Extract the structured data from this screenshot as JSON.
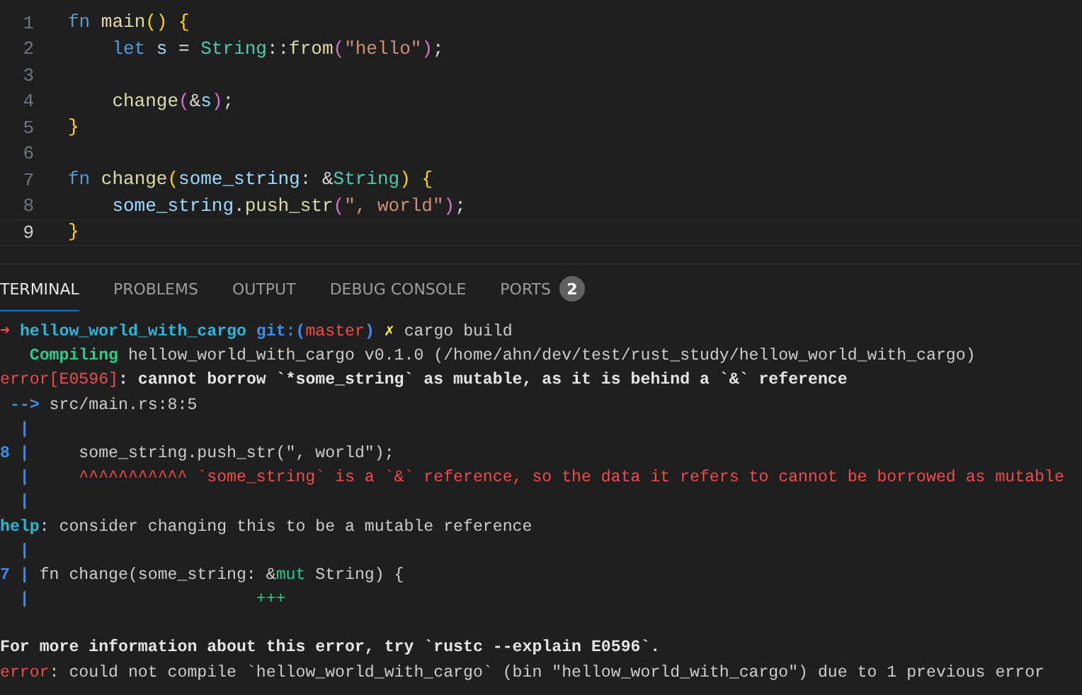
{
  "editor": {
    "lines": [
      {
        "number": "1",
        "current": false,
        "tokens": [
          {
            "kind": "keyword",
            "text": "fn"
          },
          {
            "kind": "function",
            "text": " main"
          },
          {
            "kind": "bracket",
            "text": "()"
          },
          {
            "kind": "bracket",
            "text": " {"
          }
        ]
      },
      {
        "number": "2",
        "current": false,
        "tokens": [
          {
            "kind": "keyword",
            "text": "    let"
          },
          {
            "kind": "variable",
            "text": " s"
          },
          {
            "kind": "plain",
            "text": " = "
          },
          {
            "kind": "type",
            "text": "String"
          },
          {
            "kind": "plain",
            "text": "::"
          },
          {
            "kind": "function",
            "text": "from"
          },
          {
            "kind": "bracket2",
            "text": "("
          },
          {
            "kind": "string",
            "text": "\"hello\""
          },
          {
            "kind": "bracket2",
            "text": ")"
          },
          {
            "kind": "plain",
            "text": ";"
          }
        ]
      },
      {
        "number": "3",
        "current": false
      },
      {
        "number": "4",
        "current": false,
        "tokens": [
          {
            "kind": "function",
            "text": "    change"
          },
          {
            "kind": "bracket2",
            "text": "("
          },
          {
            "kind": "plain",
            "text": "&"
          },
          {
            "kind": "variable",
            "text": "s"
          },
          {
            "kind": "bracket2",
            "text": ")"
          },
          {
            "kind": "plain",
            "text": ";"
          }
        ]
      },
      {
        "number": "5",
        "current": false,
        "tokens": [
          {
            "kind": "bracket",
            "text": "}"
          }
        ]
      },
      {
        "number": "6",
        "current": false
      },
      {
        "number": "7",
        "current": false,
        "tokens": [
          {
            "kind": "keyword",
            "text": "fn"
          },
          {
            "kind": "function",
            "text": " change"
          },
          {
            "kind": "bracket",
            "text": "("
          },
          {
            "kind": "variable",
            "text": "some_string"
          },
          {
            "kind": "plain",
            "text": ": &"
          },
          {
            "kind": "type",
            "text": "String"
          },
          {
            "kind": "bracket",
            "text": ")"
          },
          {
            "kind": "bracket",
            "text": " {"
          }
        ]
      },
      {
        "number": "8",
        "current": false,
        "tokens": [
          {
            "kind": "variable",
            "text": "    some_string"
          },
          {
            "kind": "plain",
            "text": "."
          },
          {
            "kind": "function",
            "text": "push_str"
          },
          {
            "kind": "bracket2",
            "text": "("
          },
          {
            "kind": "string",
            "text": "\", world\""
          },
          {
            "kind": "bracket2",
            "text": ")"
          },
          {
            "kind": "plain",
            "text": ";"
          }
        ]
      },
      {
        "number": "9",
        "current": true,
        "tokens": [
          {
            "kind": "bracket",
            "text": "}"
          }
        ]
      }
    ]
  },
  "panel_tabs": [
    {
      "label": "TERMINAL",
      "selected": true
    },
    {
      "label": "PROBLEMS",
      "selected": false
    },
    {
      "label": "OUTPUT",
      "selected": false
    },
    {
      "label": "DEBUG CONSOLE",
      "selected": false
    },
    {
      "label": "PORTS",
      "selected": false,
      "badge": "2"
    }
  ],
  "terminal": {
    "lines": [
      {
        "tokens": [
          {
            "kind": "red",
            "text": "➜ "
          },
          {
            "kind": "cyanbold",
            "text": "hellow_world_with_cargo"
          },
          {
            "kind": "bluebold",
            "text": " git:("
          },
          {
            "kind": "redbold",
            "text": "master"
          },
          {
            "kind": "bluebold",
            "text": ")"
          },
          {
            "kind": "yellow",
            "text": " ✗ "
          },
          {
            "kind": "plain",
            "text": "cargo build"
          }
        ]
      },
      {
        "tokens": [
          {
            "kind": "greenbold",
            "text": "   Compiling"
          },
          {
            "kind": "plain",
            "text": " hellow_world_with_cargo v0.1.0 (/home/ahn/dev/test/rust_study/hellow_world_with_cargo)"
          }
        ]
      },
      {
        "tokens": [
          {
            "kind": "redbold",
            "text": "error[E0596]"
          },
          {
            "kind": "bold",
            "text": ": cannot borrow `*some_string` as mutable, as it is behind a `&` reference"
          }
        ]
      },
      {
        "tokens": [
          {
            "kind": "bluebold",
            "text": " --> "
          },
          {
            "kind": "plain",
            "text": "src/main.rs:8:5"
          }
        ]
      },
      {
        "tokens": [
          {
            "kind": "bluebold",
            "text": "  |"
          }
        ]
      },
      {
        "tokens": [
          {
            "kind": "bluebold",
            "text": "8 |"
          },
          {
            "kind": "plain",
            "text": "     some_string.push_str(\", world\");"
          }
        ]
      },
      {
        "tokens": [
          {
            "kind": "bluebold",
            "text": "  |"
          },
          {
            "kind": "redbold",
            "text": "     ^^^^^^^^^^^ `some_string` is a `&` reference, so the data it refers to cannot be borrowed as mutable"
          }
        ]
      },
      {
        "tokens": [
          {
            "kind": "bluebold",
            "text": "  |"
          }
        ]
      },
      {
        "tokens": [
          {
            "kind": "cyanbold",
            "text": "help"
          },
          {
            "kind": "plain",
            "text": ": consider changing this to be a mutable reference"
          }
        ]
      },
      {
        "tokens": [
          {
            "kind": "bluebold",
            "text": "  |"
          }
        ]
      },
      {
        "tokens": [
          {
            "kind": "bluebold",
            "text": "7 |"
          },
          {
            "kind": "plain",
            "text": " fn change(some_string: &"
          },
          {
            "kind": "green",
            "text": "mut"
          },
          {
            "kind": "plain",
            "text": " String) {"
          }
        ]
      },
      {
        "tokens": [
          {
            "kind": "bluebold",
            "text": "  |"
          },
          {
            "kind": "green",
            "text": "                       +++"
          }
        ]
      },
      {
        "kind": "blank"
      },
      {
        "tokens": [
          {
            "kind": "bold",
            "text": "For more information about this error, try `rustc --explain E0596`."
          }
        ]
      },
      {
        "tokens": [
          {
            "kind": "redbold",
            "text": "error"
          },
          {
            "kind": "plain",
            "text": ": could not compile `hellow_world_with_cargo` (bin \"hellow_world_with_cargo\") due to 1 previous error"
          }
        ]
      }
    ]
  }
}
